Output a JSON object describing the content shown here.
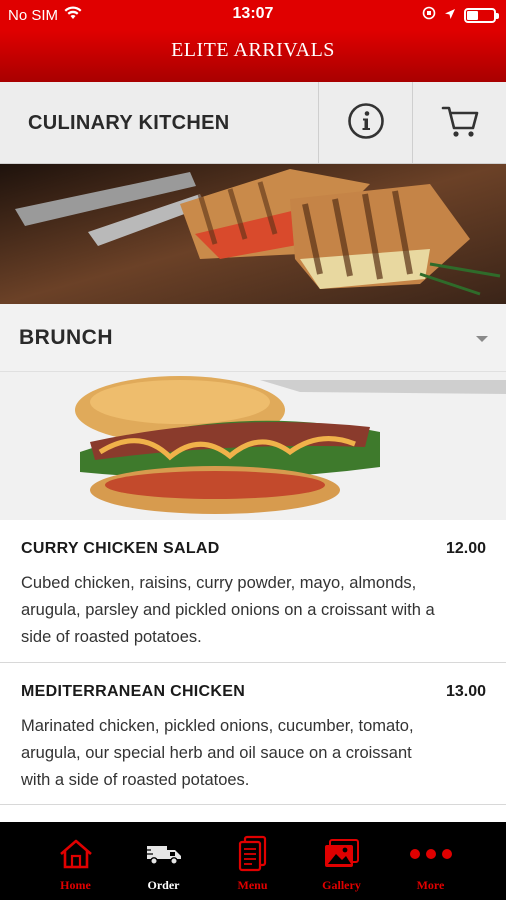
{
  "status": {
    "carrier": "No SIM",
    "time": "13:07",
    "battery_level": 0.4
  },
  "header": {
    "title": "ELITE ARRIVALS"
  },
  "brand": {
    "name": "CULINARY KITCHEN",
    "info_icon": "info-icon",
    "cart_icon": "cart-icon"
  },
  "category": {
    "selected": "BRUNCH"
  },
  "menu": {
    "items": [
      {
        "name": "CURRY CHICKEN SALAD",
        "price": "12.00",
        "description": "Cubed chicken, raisins, curry powder, mayo, almonds, arugula, parsley and pickled onions on a croissant with a side of roasted potatoes."
      },
      {
        "name": "MEDITERRANEAN CHICKEN",
        "price": "13.00",
        "description": "Marinated chicken, pickled onions, cucumber, tomato, arugula, our special herb and oil sauce on a croissant with a side of roasted potatoes."
      }
    ]
  },
  "tabs": [
    {
      "label": "Home",
      "icon": "home-icon"
    },
    {
      "label": "Order",
      "icon": "truck-icon"
    },
    {
      "label": "Menu",
      "icon": "menu-document-icon"
    },
    {
      "label": "Gallery",
      "icon": "gallery-icon"
    },
    {
      "label": "More",
      "icon": "more-dots-icon"
    }
  ],
  "colors": {
    "brand_red": "#e00000",
    "tabbar_bg": "#000000",
    "active_tab": "#ffffff"
  }
}
